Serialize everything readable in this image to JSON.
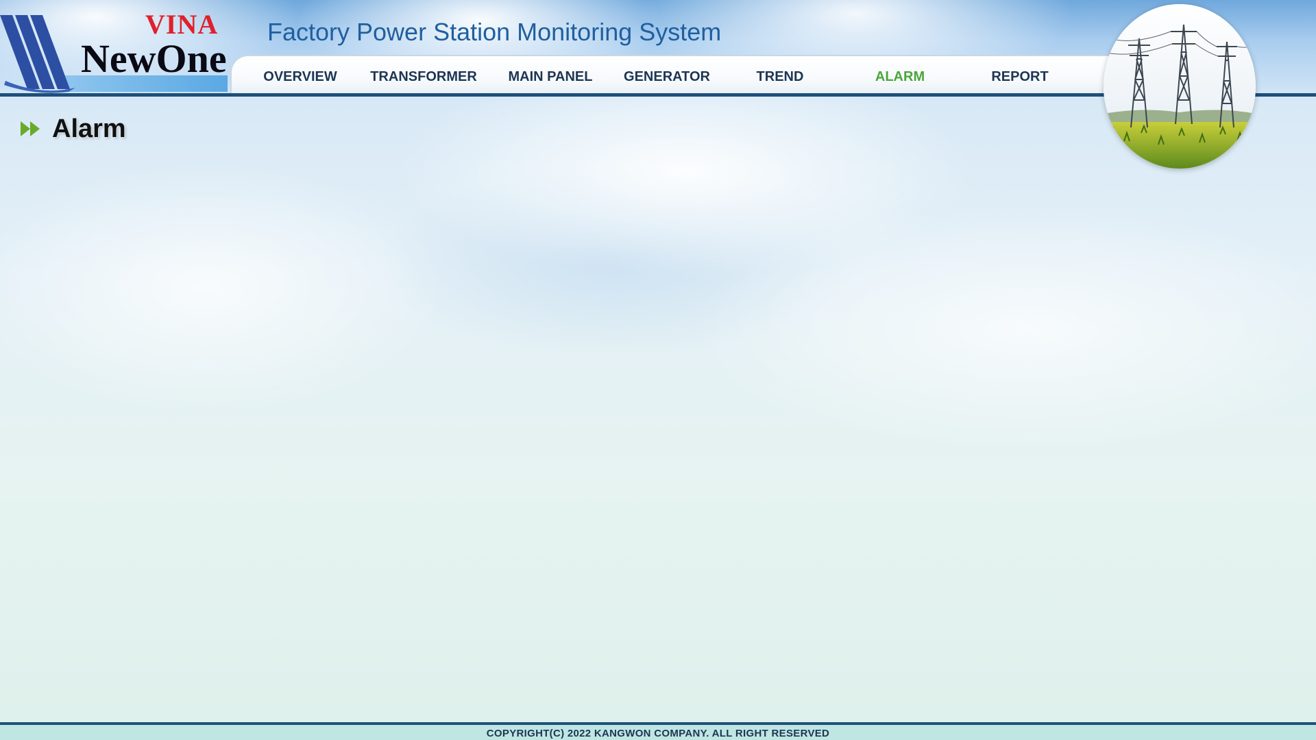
{
  "app": {
    "title": "Factory Power Station Monitoring System"
  },
  "logo": {
    "word_top": "VINA",
    "word_main": "NewOne"
  },
  "nav": {
    "items": [
      {
        "label": "OVERVIEW",
        "active": false
      },
      {
        "label": "TRANSFORMER",
        "active": false
      },
      {
        "label": "MAIN PANEL",
        "active": false
      },
      {
        "label": "GENERATOR",
        "active": false
      },
      {
        "label": "TREND",
        "active": false
      },
      {
        "label": "ALARM",
        "active": true
      },
      {
        "label": "REPORT",
        "active": false
      }
    ]
  },
  "page": {
    "title": "Alarm",
    "title_icon": "double-chevron-right-icon"
  },
  "footer": {
    "copyright": "COPYRIGHT(C) 2022 KANGWON COMPANY. ALL RIGHT RESERVED"
  },
  "colors": {
    "nav_active": "#4aa63a",
    "nav_text": "#1e3552",
    "title_blue": "#1f5f9f",
    "header_line": "#1e4f7a",
    "logo_red": "#e0202a",
    "icon_green": "#6aaa2a"
  }
}
